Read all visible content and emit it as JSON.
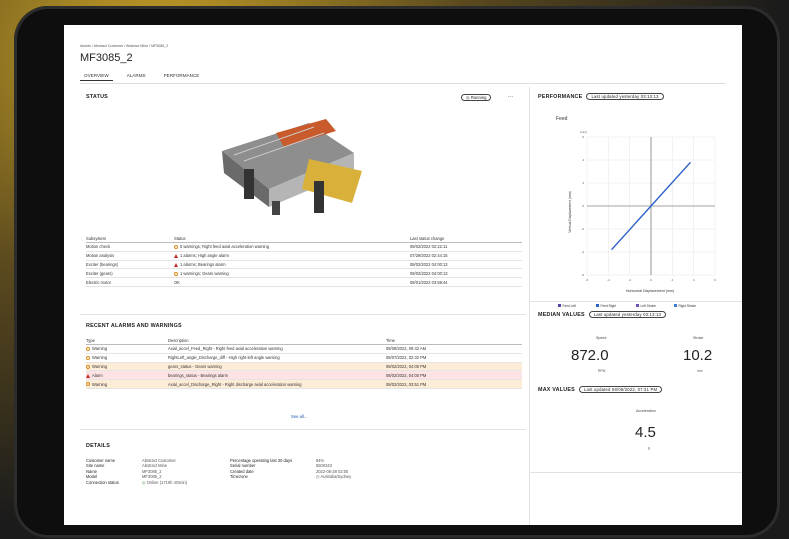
{
  "breadcrumb": "Assets / Abstract Customer / Abstract Mine / MF3085_2",
  "asset_title": "MF3085_2",
  "tabs": [
    "OVERVIEW",
    "ALARMS",
    "PERFORMANCE"
  ],
  "status": {
    "title": "STATUS",
    "state": "Running",
    "more": "...",
    "columns": [
      "Subsystem",
      "Status",
      "Last status change"
    ],
    "rows": [
      {
        "subsystem": "Motion check",
        "icon": "warning-icon",
        "status": "5 warnings; Right feed axial acceleration warning",
        "changed": "08/02/2022 02:22:11"
      },
      {
        "subsystem": "Motion analysis",
        "icon": "alarm-icon",
        "status": "1 alarms; High angle alarm",
        "changed": "07/29/2022 02:44:15"
      },
      {
        "subsystem": "Exciter (bearings)",
        "icon": "alarm-icon",
        "status": "1 alarms; Bearings alarm",
        "changed": "08/02/2022 04:00:13"
      },
      {
        "subsystem": "Exciter (gears)",
        "icon": "warning-icon",
        "status": "1 warnings; Gears warning",
        "changed": "08/02/2022 04:00:13"
      },
      {
        "subsystem": "Electric motor",
        "icon": "",
        "status": "OK",
        "changed": "08/01/2022 03:59:44"
      }
    ]
  },
  "alarms": {
    "title": "RECENT ALARMS AND WARNINGS",
    "columns": [
      "Type",
      "Description",
      "Time"
    ],
    "rows": [
      {
        "type": "Warning",
        "icon": "warning-icon",
        "desc": "Axial_accel_Feed_Right - Right feed axial acceleration warning",
        "time": "08/08/2022, 09:42 AM",
        "highlight": ""
      },
      {
        "type": "Warning",
        "icon": "warning-icon",
        "desc": "RightLeft_angle_Discharge_diff - High right-left angle warning",
        "time": "08/07/2022, 02:32 PM",
        "highlight": ""
      },
      {
        "type": "Warning",
        "icon": "warning-icon",
        "desc": "gears_status - Gears warning",
        "time": "08/02/2022, 04:00 PM",
        "highlight": "warn"
      },
      {
        "type": "Alarm",
        "icon": "alarm-icon",
        "desc": "bearings_status - Bearings alarm",
        "time": "08/02/2022, 04:00 PM",
        "highlight": "alarm"
      },
      {
        "type": "Warning",
        "icon": "warning-icon",
        "desc": "Axial_accel_Discharge_Right - Right discharge axial acceleration warning",
        "time": "08/02/2022, 03:51 PM",
        "highlight": "warn"
      }
    ],
    "see_all": "See all..."
  },
  "details": {
    "title": "DETAILS",
    "left": [
      {
        "label": "Customer name",
        "value": "Abstract Customer"
      },
      {
        "label": "Site name",
        "value": "Abstract Mine"
      },
      {
        "label": "Name",
        "value": "MF3085_2"
      },
      {
        "label": "Model",
        "value": "MF3085_2"
      },
      {
        "label": "Connection status",
        "value": "Online (1710h 4Omin)"
      }
    ],
    "right": [
      {
        "label": "Percentage operating last 30 days",
        "value": "94%"
      },
      {
        "label": "Serial number",
        "value": "5500343"
      },
      {
        "label": "Created date",
        "value": "2022-05-28 02:05"
      },
      {
        "label": "Timezone",
        "value": "Australia/Sydney"
      }
    ]
  },
  "performance": {
    "title": "PERFORMANCE",
    "updated": "Last updated yesterday 03:13:13"
  },
  "chart_data": {
    "type": "line",
    "title": "Feed",
    "xlabel": "Horizontal Displacement (mm)",
    "ylabel": "Vertical Displacement (mm)",
    "yunit": "(mm)",
    "xlim": [
      -6,
      6
    ],
    "ylim": [
      -6,
      6
    ],
    "x_ticks": [
      -6,
      -4,
      -2,
      0,
      2,
      4,
      6
    ],
    "y_ticks": [
      -6,
      -4,
      -2,
      0,
      2,
      4,
      6
    ],
    "grid": true,
    "series": [
      {
        "name": "Feed Left",
        "color": "#5b3fa8",
        "x": [],
        "y": []
      },
      {
        "name": "Feed Right",
        "color": "#2a5fc9",
        "x": [
          -3.7,
          3.7
        ],
        "y": [
          -3.8,
          3.8
        ]
      },
      {
        "name": "Left Stroke",
        "color": "#6d4fb8",
        "x": [],
        "y": []
      },
      {
        "name": "Right Stroke",
        "color": "#3f7ad6",
        "x": [],
        "y": []
      }
    ]
  },
  "median": {
    "title": "MEDIAN VALUES",
    "updated": "Last updated yesterday 03:13:13",
    "speed_label": "Speed",
    "speed_value": "872.0",
    "speed_unit": "RPM",
    "stroke_label": "Stroke",
    "stroke_value": "10.2",
    "stroke_unit": "mm"
  },
  "max": {
    "title": "MAX VALUES",
    "updated": "Last updated 08/08/2022, 07:31 PM",
    "accel_label": "Acceleration",
    "accel_value": "4.5",
    "accel_unit": "g"
  },
  "colors": {
    "warning": "#d98b1c",
    "alarm": "#c62828",
    "line": "#2a5fc9",
    "link": "#1a56b0"
  }
}
